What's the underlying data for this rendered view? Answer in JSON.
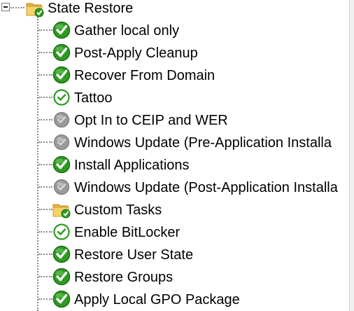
{
  "tree": {
    "root": {
      "label": "State Restore",
      "icon": "group-folder-check-icon",
      "expander": "collapse-minus-icon"
    },
    "children": [
      {
        "label": "Gather local only",
        "icon": "enabled-check-icon",
        "status": "enabled"
      },
      {
        "label": "Post-Apply Cleanup",
        "icon": "enabled-check-icon",
        "status": "enabled"
      },
      {
        "label": "Recover From Domain",
        "icon": "enabled-check-icon",
        "status": "enabled"
      },
      {
        "label": "Tattoo",
        "icon": "check-outline-icon",
        "status": "enabled-no-conditions"
      },
      {
        "label": "Opt In to CEIP and WER",
        "icon": "disabled-gray-icon",
        "status": "disabled"
      },
      {
        "label": "Windows Update (Pre-Application Installa",
        "icon": "disabled-gray-icon",
        "status": "disabled"
      },
      {
        "label": "Install Applications",
        "icon": "enabled-check-icon",
        "status": "enabled"
      },
      {
        "label": "Windows Update (Post-Application Installa",
        "icon": "disabled-gray-icon",
        "status": "disabled"
      },
      {
        "label": "Custom Tasks",
        "icon": "group-folder-check-icon",
        "status": "group"
      },
      {
        "label": "Enable BitLocker",
        "icon": "check-outline-icon",
        "status": "enabled-no-conditions"
      },
      {
        "label": "Restore User State",
        "icon": "enabled-check-icon",
        "status": "enabled"
      },
      {
        "label": "Restore Groups",
        "icon": "enabled-check-icon",
        "status": "enabled"
      },
      {
        "label": "Apply Local GPO Package",
        "icon": "enabled-check-icon",
        "status": "enabled"
      }
    ]
  },
  "colors": {
    "check_green": "#2e9a22",
    "check_green_dark": "#1b6e14",
    "disabled_gray": "#9a9a9a",
    "folder_yellow": "#f2c64a",
    "tree_line": "#8c8c8c"
  }
}
